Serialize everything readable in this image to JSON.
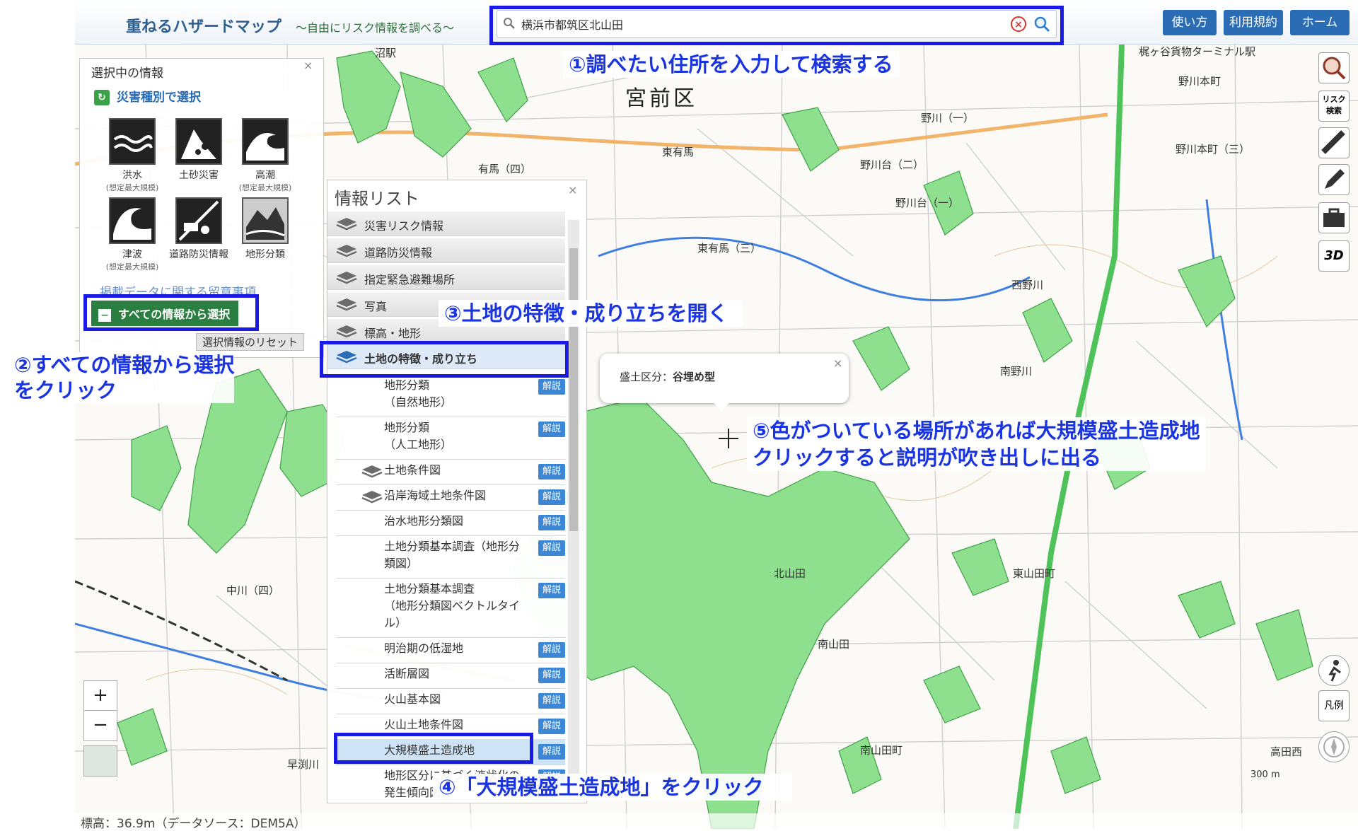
{
  "header": {
    "title": "重ねるハザードマップ",
    "subtitle": "～自由にリスク情報を調べる～",
    "search_value": "横浜市都筑区北山田",
    "buttons": [
      "使い方",
      "利用規約",
      "ホーム"
    ]
  },
  "selection_panel": {
    "title": "選択中の情報",
    "section_title": "災害種別で選択",
    "hazards": [
      {
        "label": "洪水",
        "note": "(想定最大規模)"
      },
      {
        "label": "土砂災害",
        "note": ""
      },
      {
        "label": "高潮",
        "note": "(想定最大規模)"
      },
      {
        "label": "津波",
        "note": "(想定最大規模)"
      },
      {
        "label": "道路防災情報",
        "note": ""
      },
      {
        "label": "地形分類",
        "note": ""
      }
    ],
    "notice_link": "掲載データに関する留意事項",
    "all_info_button": "すべての情報から選択",
    "reset_button": "選択情報のリセット"
  },
  "info_list": {
    "title": "情報リスト",
    "top_items": [
      "災害リスク情報",
      "道路防災情報",
      "指定緊急避難場所",
      "写真",
      "標高・地形"
    ],
    "open_item": "土地の特徴・成り立ち",
    "explain_label": "解説",
    "sub_items": [
      {
        "line1": "地形分類",
        "line2": "（自然地形）"
      },
      {
        "line1": "地形分類",
        "line2": "（人工地形）"
      },
      {
        "line1": "土地条件図",
        "line2": ""
      },
      {
        "line1": "沿岸海域土地条件図",
        "line2": ""
      },
      {
        "line1": "治水地形分類図",
        "line2": ""
      },
      {
        "line1": "土地分類基本調査（地形分",
        "line2": "類図）"
      },
      {
        "line1": "土地分類基本調査",
        "line2": "（地形分類図ベクトルタイ",
        "line3": "ル）"
      },
      {
        "line1": "明治期の低湿地",
        "line2": ""
      },
      {
        "line1": "活断層図",
        "line2": ""
      },
      {
        "line1": "火山基本図",
        "line2": ""
      },
      {
        "line1": "火山土地条件図",
        "line2": ""
      },
      {
        "line1": "大規模盛土造成地",
        "line2": ""
      },
      {
        "line1": "地形区分に基づく液状化の",
        "line2": "発生傾向図"
      }
    ]
  },
  "popup": {
    "label": "盛土区分：",
    "value": "谷埋め型"
  },
  "annotations": {
    "step1": "①調べたい住所を入力して検索する",
    "step2_line1": "②すべての情報から選択",
    "step2_line2": "をクリック",
    "step3": "③土地の特徴・成り立ちを開く",
    "step4": "④「大規模盛土造成地」をクリック",
    "step5_line1": "⑤色がついている場所があれば大規模盛土造成地",
    "step5_line2": "クリックすると説明が吹き出しに出る"
  },
  "map_labels": {
    "ward": "宮前区",
    "places": [
      "東有馬",
      "有馬（四）",
      "東有馬（三）",
      "野川（一）",
      "野川台（二）",
      "野川台（一）",
      "西野川",
      "南野川",
      "北山田",
      "東山田町",
      "南山田",
      "南山田町",
      "中川（四）",
      "早渕川",
      "野川本町",
      "野川本町（三）",
      "梶ヶ谷貨物ターミナル駅",
      "高田西",
      "沼駅"
    ],
    "elevation": "標高：36.9m（データソース：DEM5A）",
    "scale": "300 m",
    "legend_btn": "凡例"
  },
  "tool_labels": {
    "risk_search": "リスク検索",
    "three_d": "3D"
  },
  "colors": {
    "accent": "#2a6db4",
    "highlight_box": "#1a1ae6",
    "fill_area": "#8ee08e",
    "annotation_text": "#1a35e0"
  }
}
